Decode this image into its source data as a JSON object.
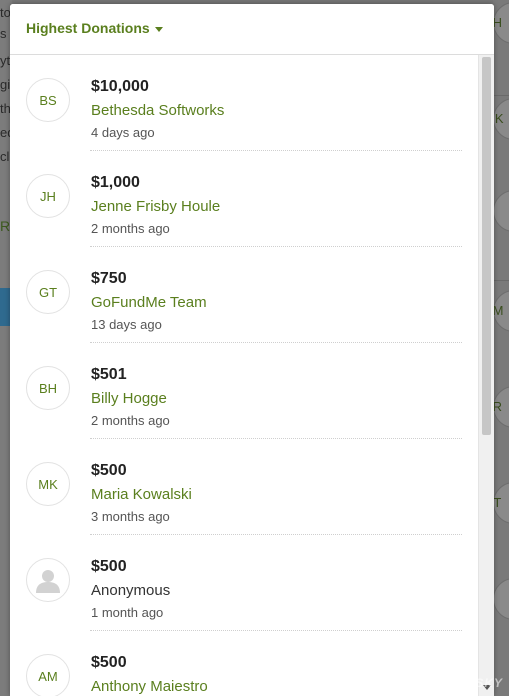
{
  "background": {
    "left_text_fragments": [
      "to",
      "s",
      "yt",
      "gi",
      "th",
      "ed",
      "cl"
    ],
    "left_partial_button": "R",
    "right_avatars": [
      "BH",
      "MK",
      "AM",
      "VR",
      "CT"
    ]
  },
  "modal": {
    "sort_label": "Highest Donations",
    "donations": [
      {
        "initials": "BS",
        "amount": "$10,000",
        "name": "Bethesda Softworks",
        "time": "4 days ago",
        "anonymous": false
      },
      {
        "initials": "JH",
        "amount": "$1,000",
        "name": "Jenne Frisby Houle",
        "time": "2 months ago",
        "anonymous": false
      },
      {
        "initials": "GT",
        "amount": "$750",
        "name": "GoFundMe Team",
        "time": "13 days ago",
        "anonymous": false
      },
      {
        "initials": "BH",
        "amount": "$501",
        "name": "Billy Hogge",
        "time": "2 months ago",
        "anonymous": false
      },
      {
        "initials": "MK",
        "amount": "$500",
        "name": "Maria Kowalski",
        "time": "3 months ago",
        "anonymous": false
      },
      {
        "initials": "",
        "amount": "$500",
        "name": "Anonymous",
        "time": "1 month ago",
        "anonymous": true
      },
      {
        "initials": "AM",
        "amount": "$500",
        "name": "Anthony Maiestro",
        "time": "",
        "anonymous": false
      }
    ]
  },
  "watermark": "GAMERSKY",
  "colors": {
    "accent_green": "#5a7f1e",
    "overlay": "#777777"
  }
}
